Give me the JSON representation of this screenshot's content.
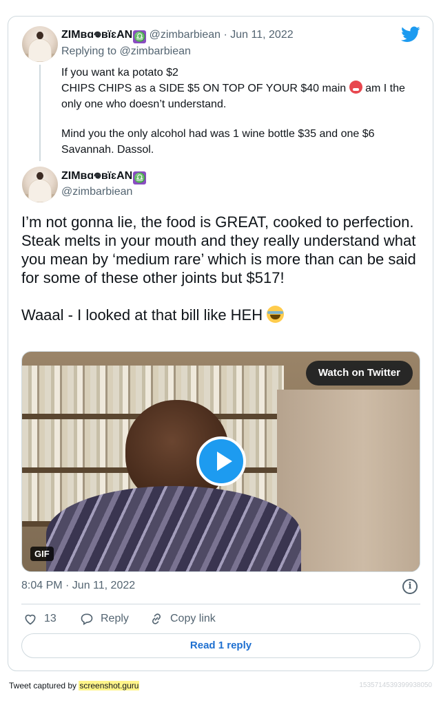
{
  "parent_tweet": {
    "display_name": "ZIMʙɑ𖦹ʙïɛAN",
    "zodiac_icon": "♎",
    "handle_date": "@zimbarbiean · Jun 11, 2022",
    "replying_to": "Replying to @zimbarbiean",
    "line1": "If you want ka potato $2",
    "line2a": "CHIPS CHIPS as a SIDE $5 ON TOP OF YOUR $40 main ",
    "line2b": " am I the only one who doesn’t understand.",
    "line3": "Mind you the only alcohol had was 1 wine bottle $35 and one $6 Savannah. Dassol."
  },
  "main_tweet": {
    "display_name": "ZIMʙɑ𖦹ʙïɛAN",
    "zodiac_icon": "♎",
    "handle": "@zimbarbiean",
    "para1": "I’m not gonna lie, the food is GREAT,  cooked to perfection. Steak melts in your mouth and they really understand what you mean by ‘medium rare’ which is more than can be said for some of these other joints but $517!",
    "para2": "Waaal - I looked at that bill like HEH "
  },
  "media": {
    "gif_label": "GIF",
    "watch_label": "Watch on Twitter"
  },
  "footer": {
    "timestamp": "8:04 PM · Jun 11, 2022",
    "likes": "13",
    "reply_label": "Reply",
    "copy_label": "Copy link",
    "read_replies": "Read 1 reply"
  },
  "page": {
    "captured_prefix": "Tweet captured by ",
    "captured_site": "screenshot.guru",
    "tweet_id": "1535714539399938050"
  },
  "colors": {
    "twitter_blue": "#1d9bf0",
    "muted_text": "#536471",
    "border": "#cfd9de"
  }
}
